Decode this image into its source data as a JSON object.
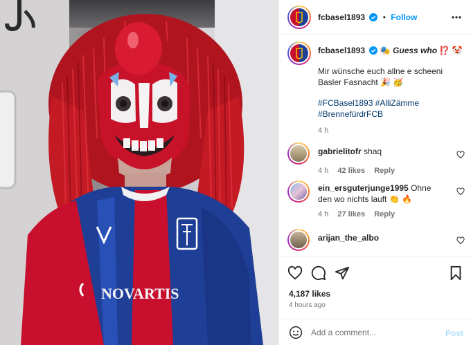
{
  "header": {
    "username": "fcbasel1893",
    "separator": "•",
    "follow_label": "Follow",
    "more_icon": "more-horizontal-icon"
  },
  "caption": {
    "username": "fcbasel1893",
    "title_emoji": "🎭",
    "title_text": "Guess who",
    "title_emoji_after": "⁉️ 🤡",
    "body": "Mir wünsche euch allne e scheeni Basler Fasnacht 🎉 🥳",
    "hashtags": "#FCBasel1893 #AlliZämme #BrennefürdrFCB",
    "time": "4 h"
  },
  "comments": [
    {
      "username": "gabrielitofr",
      "text": "shaq",
      "time": "4 h",
      "likes": "42 likes",
      "reply": "Reply"
    },
    {
      "username": "ein_ersguterjunge1995",
      "text": "Ohne den wo nichts lauft 👏 🔥",
      "time": "4 h",
      "likes": "27 likes",
      "reply": "Reply"
    },
    {
      "username": "arijan_the_albo",
      "text": ""
    }
  ],
  "actions": {
    "likes": "4,187 likes",
    "posted": "4 hours ago"
  },
  "add_comment": {
    "placeholder": "Add a comment...",
    "post_label": "Post"
  },
  "photo": {
    "jersey_sponsor": "NOVARTIS",
    "colors": {
      "mask_red": "#d0142c",
      "hair_red": "#c41a24",
      "jersey_blue": "#1f3f97",
      "jersey_red": "#c8102e"
    }
  }
}
